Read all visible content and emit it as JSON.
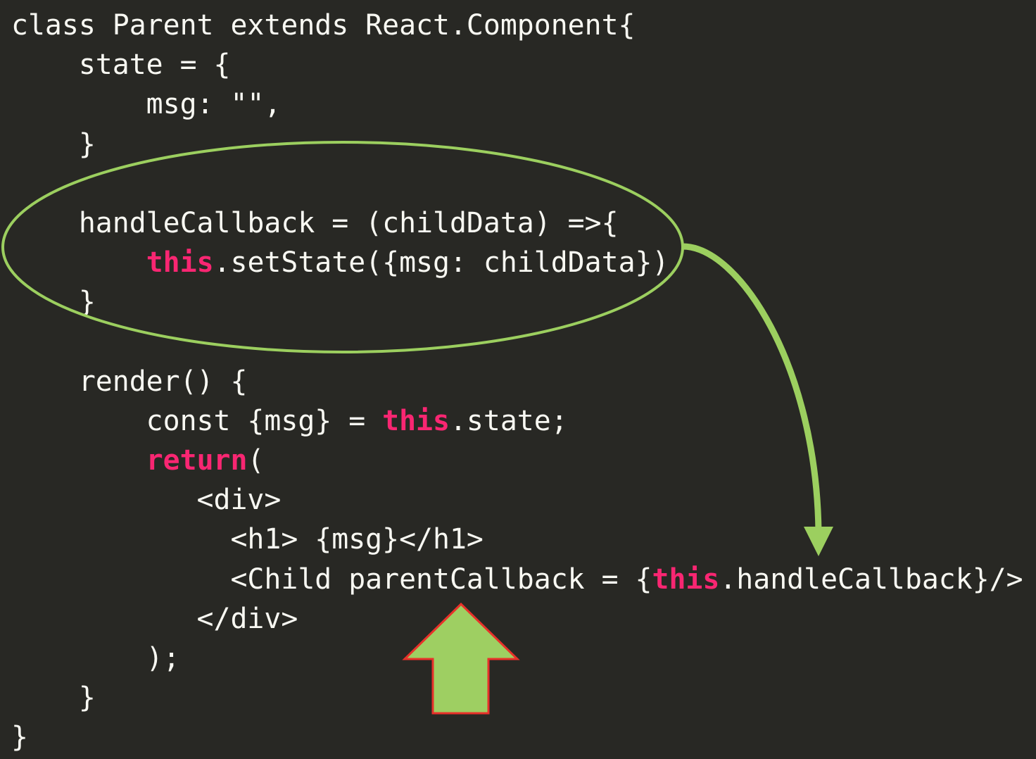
{
  "code": {
    "lines": [
      [
        {
          "t": "class Parent extends React.Component{"
        }
      ],
      [
        {
          "t": "    state = {"
        }
      ],
      [
        {
          "t": "        msg: \"\","
        }
      ],
      [
        {
          "t": "    }"
        }
      ],
      [
        {
          "t": ""
        }
      ],
      [
        {
          "t": "    handleCallback = (childData) =>{"
        }
      ],
      [
        {
          "t": "        "
        },
        {
          "t": "this",
          "k": true
        },
        {
          "t": ".setState({msg: childData})"
        }
      ],
      [
        {
          "t": "    }"
        }
      ],
      [
        {
          "t": ""
        }
      ],
      [
        {
          "t": "    render() {"
        }
      ],
      [
        {
          "t": "        const {msg} = "
        },
        {
          "t": "this",
          "k": true
        },
        {
          "t": ".state;"
        }
      ],
      [
        {
          "t": "        "
        },
        {
          "t": "return",
          "k": true
        },
        {
          "t": "("
        }
      ],
      [
        {
          "t": "           <div>"
        }
      ],
      [
        {
          "t": "             <h1> {msg}</h1>"
        }
      ],
      [
        {
          "t": "             <Child parentCallback = {"
        },
        {
          "t": "this",
          "k": true
        },
        {
          "t": ".handleCallback}/>"
        }
      ],
      [
        {
          "t": "           </div>"
        }
      ],
      [
        {
          "t": "        );"
        }
      ],
      [
        {
          "t": "    }"
        }
      ],
      [
        {
          "t": "}"
        }
      ]
    ]
  },
  "colors": {
    "background": "#282824",
    "text": "#f8f8f2",
    "keyword": "#f92672",
    "annotation_green": "#9ccf5f",
    "arrow_outline": "#e8312a"
  },
  "annotations": {
    "ellipse": "highlight-handleCallback",
    "curved_arrow": "handleCallback-to-parentCallback-prop",
    "up_arrow": "points-to-parentCallback"
  }
}
